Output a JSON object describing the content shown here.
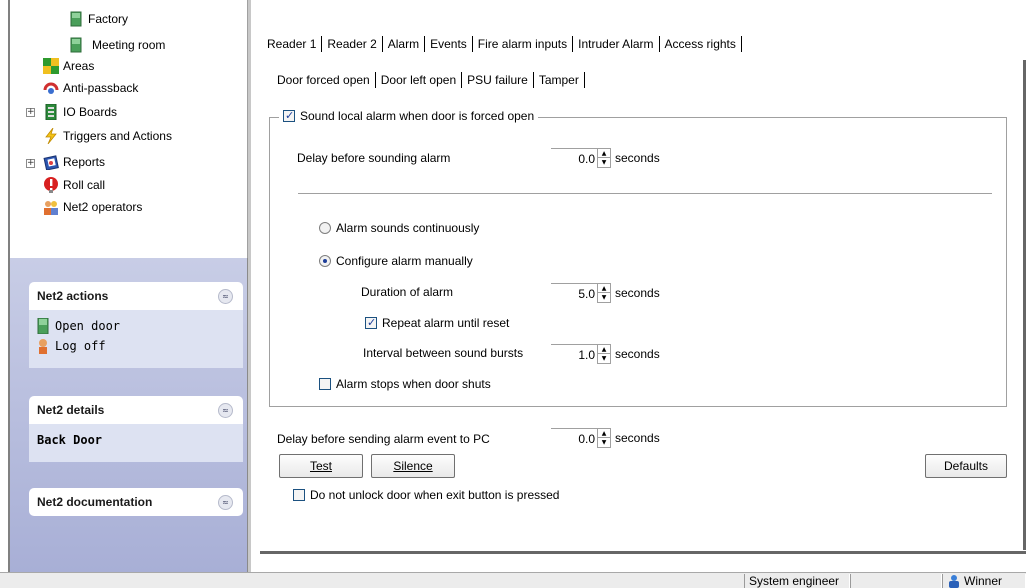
{
  "tree": {
    "items": [
      {
        "label": "Factory",
        "icon": "door-icon"
      },
      {
        "label": "Meeting room",
        "icon": "door-icon"
      },
      {
        "label": "Areas",
        "icon": "areas-icon"
      },
      {
        "label": "Anti-passback",
        "icon": "anti-passback-icon"
      },
      {
        "label": "IO Boards",
        "icon": "io-board-icon",
        "expander": "+"
      },
      {
        "label": "Triggers and Actions",
        "icon": "lightning-icon"
      },
      {
        "label": "Reports",
        "icon": "reports-icon",
        "expander": "+"
      },
      {
        "label": "Roll call",
        "icon": "roll-call-icon"
      },
      {
        "label": "Net2 operators",
        "icon": "operators-icon"
      }
    ]
  },
  "task_pane": {
    "actions": {
      "title": "Net2 actions",
      "chevron": "≈",
      "items": [
        {
          "label": "Open door",
          "icon": "door-icon"
        },
        {
          "label": "Log off",
          "icon": "user-icon"
        }
      ]
    },
    "details": {
      "title": "Net2 details",
      "chevron": "≈",
      "value": "Back Door"
    },
    "documentation": {
      "title": "Net2 documentation",
      "chevron": "≈"
    }
  },
  "tabs_main": [
    "Reader 1",
    "Reader 2",
    "Alarm",
    "Events",
    "Fire alarm inputs",
    "Intruder Alarm",
    "Access rights"
  ],
  "tabs_sub": [
    "Door forced open",
    "Door left open",
    "PSU failure",
    "Tamper"
  ],
  "form": {
    "sound_local_alarm": {
      "label": "Sound local alarm when door is forced open",
      "checked": true
    },
    "delay_sounding": {
      "label": "Delay before sounding alarm",
      "value": "0.0",
      "unit": "seconds"
    },
    "alarm_continuous": {
      "label": "Alarm sounds continuously",
      "selected": false
    },
    "configure_manually": {
      "label": "Configure alarm manually",
      "selected": true
    },
    "duration": {
      "label": "Duration of alarm",
      "value": "5.0",
      "unit": "seconds"
    },
    "repeat_until_reset": {
      "label": "Repeat alarm until reset",
      "checked": true
    },
    "interval": {
      "label": "Interval between sound bursts",
      "value": "1.0",
      "unit": "seconds"
    },
    "stops_when_shuts": {
      "label": "Alarm stops when door shuts",
      "checked": false
    },
    "delay_sending": {
      "label": "Delay before sending alarm event to PC",
      "value": "0.0",
      "unit": "seconds"
    },
    "test_button": "Test",
    "silence_button": "Silence",
    "defaults_button": "Defaults",
    "do_not_unlock": {
      "label": "Do not unlock door when exit button is pressed",
      "checked": false
    }
  },
  "statusbar": {
    "role": "System engineer",
    "user": "Winner"
  }
}
